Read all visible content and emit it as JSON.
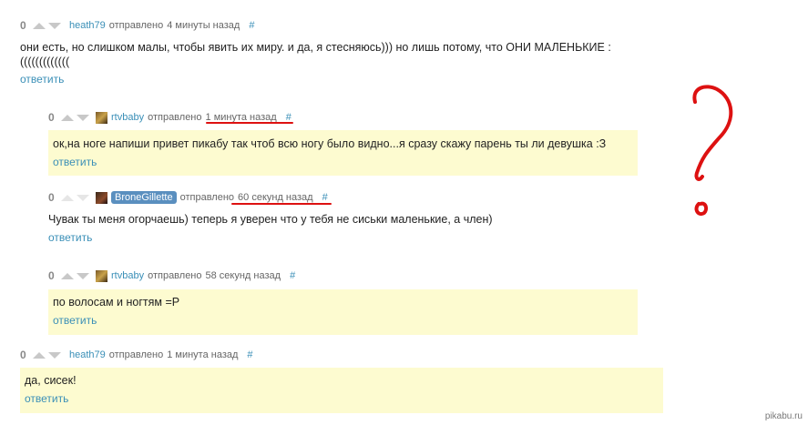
{
  "vote_label": "0",
  "comments": [
    {
      "user": "heath79",
      "sent": "отправлено",
      "time": "4 минуты назад",
      "hash": "#",
      "text_line1": "они есть, но слишком малы, чтобы явить их миру. и да, я стесняюсь))) но лишь потому, что ОНИ МАЛЕНЬКИЕ :",
      "text_line2": "(((((((((((((",
      "reply": "ответить"
    },
    {
      "user": "rtvbaby",
      "sent": "отправлено",
      "time": "1 минута назад",
      "hash": "#",
      "text": "ок,на ноге напиши привет пикабу так чтоб всю ногу было видно...я сразу скажу парень ты ли девушка :З",
      "reply": "ответить"
    },
    {
      "user": "BroneGillette",
      "sent": "отправлено",
      "time": "60 секунд назад",
      "hash": "#",
      "text": "Чувак ты меня огорчаешь) теперь я уверен что у тебя не сиськи маленькие, а член)",
      "reply": "ответить"
    },
    {
      "user": "rtvbaby",
      "sent": "отправлено",
      "time": "58 секунд назад",
      "hash": "#",
      "text": "по волосам и ногтям =Р",
      "reply": "ответить"
    },
    {
      "user": "heath79",
      "sent": "отправлено",
      "time": "1 минута назад",
      "hash": "#",
      "text": "да, сисек!",
      "reply": "ответить"
    }
  ],
  "watermark": "pikabu.ru",
  "annotation_color": "#dd1111"
}
